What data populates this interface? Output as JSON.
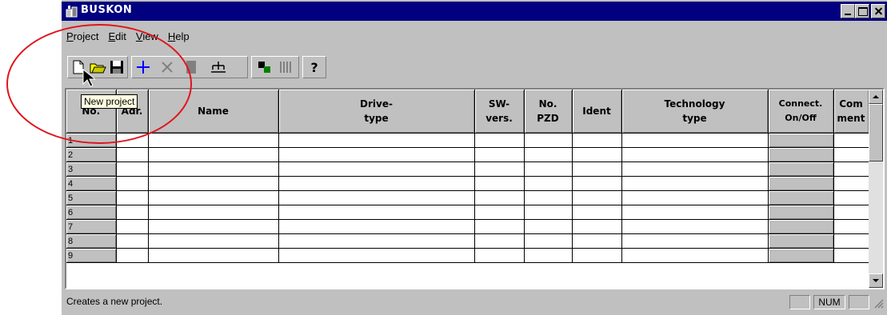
{
  "window": {
    "title": "BUSKON"
  },
  "menu": [
    {
      "label_u": "P",
      "label_rest": "roject"
    },
    {
      "label_u": "E",
      "label_rest": "dit"
    },
    {
      "label_u": "V",
      "label_rest": "iew"
    },
    {
      "label_u": "H",
      "label_rest": "elp"
    }
  ],
  "toolbar": {
    "buttons": [
      "new-document-icon",
      "open-folder-icon",
      "save-icon",
      "add-plus-icon",
      "delete-x-icon",
      "block-icon",
      "hierarchy-icon",
      "connect-icon",
      "columns-icon",
      "help-icon"
    ]
  },
  "tooltip": "New project",
  "grid": {
    "headers": {
      "no": "No.",
      "adr": "Adr.",
      "name": "Name",
      "drive_type": "Drive-\ntype",
      "sw_vers": "SW-\nvers.",
      "no_pzd": "No.\nPZD",
      "ident": "Ident",
      "technology_type": "Technology\ntype",
      "connect": "Connect.\nOn/Off",
      "comment": "Com\nment"
    },
    "rows": [
      "1",
      "2",
      "3",
      "4",
      "5",
      "6",
      "7",
      "8",
      "9"
    ]
  },
  "status": {
    "text": "Creates a new project.",
    "num": "NUM"
  },
  "colors": {
    "titlebar": "#000080",
    "annotation_circle": "#e0141e",
    "face": "#c0c0c0"
  }
}
